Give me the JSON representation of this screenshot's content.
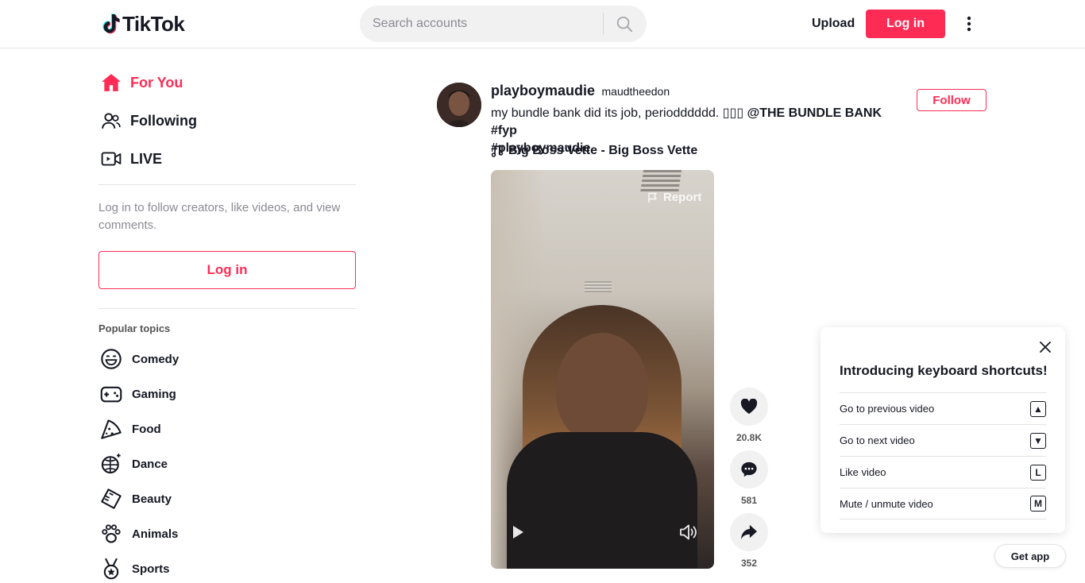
{
  "header": {
    "logo_text": "TikTok",
    "search_placeholder": "Search accounts",
    "upload_label": "Upload",
    "login_label": "Log in"
  },
  "sidebar": {
    "nav": [
      {
        "label": "For You",
        "icon": "home-icon",
        "active": true
      },
      {
        "label": "Following",
        "icon": "users-icon"
      },
      {
        "label": "LIVE",
        "icon": "live-icon"
      }
    ],
    "login_hint": "Log in to follow creators, like videos, and view comments.",
    "login_button": "Log in",
    "topics_title": "Popular topics",
    "topics": [
      {
        "label": "Comedy",
        "icon": "smile-icon"
      },
      {
        "label": "Gaming",
        "icon": "gamepad-icon"
      },
      {
        "label": "Food",
        "icon": "pizza-icon"
      },
      {
        "label": "Dance",
        "icon": "disco-ball-icon"
      },
      {
        "label": "Beauty",
        "icon": "comb-icon"
      },
      {
        "label": "Animals",
        "icon": "paw-icon"
      },
      {
        "label": "Sports",
        "icon": "medal-icon"
      }
    ]
  },
  "post": {
    "author_name": "playboymaudie",
    "author_nick": "maudtheedon",
    "caption_text": "my bundle bank did its job, periodddddd. ",
    "caption_emoji": "▯▯▯",
    "caption_mention": " @THE BUNDLE BANK",
    "caption_tag1": " #fyp",
    "caption_tag2": "#playboymaudie",
    "music": "Big Boss Vette - Big Boss Vette",
    "follow_label": "Follow",
    "report_label": "Report",
    "likes": "20.8K",
    "comments": "581",
    "shares": "352"
  },
  "keyboard_panel": {
    "title": "Introducing keyboard shortcuts!",
    "rows": [
      {
        "label": "Go to previous video",
        "key": "▲"
      },
      {
        "label": "Go to next video",
        "key": "▼"
      },
      {
        "label": "Like video",
        "key": "L"
      },
      {
        "label": "Mute / unmute video",
        "key": "M"
      }
    ]
  },
  "get_app_label": "Get app",
  "colors": {
    "accent": "#fe2c55",
    "text": "#161823",
    "muted": "#8a8b91"
  }
}
